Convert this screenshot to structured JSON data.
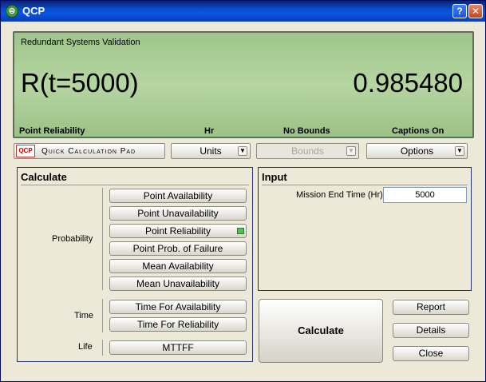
{
  "window": {
    "title": "QCP"
  },
  "display": {
    "title": "Redundant Systems Validation",
    "left_text": "R(t=5000)",
    "value": "0.985480",
    "captions": [
      "Point Reliability",
      "Hr",
      "No Bounds",
      "Captions On"
    ]
  },
  "toolbar": {
    "qcp_logo": "QCP",
    "qcp_label": "Quick Calculation Pad",
    "units": "Units",
    "bounds": "Bounds",
    "options": "Options"
  },
  "calculate": {
    "title": "Calculate",
    "probability_label": "Probability",
    "probability_buttons": [
      "Point Availability",
      "Point Unavailability",
      "Point Reliability",
      "Point Prob. of Failure",
      "Mean Availability",
      "Mean Unavailability"
    ],
    "selected": "Point Reliability",
    "time_label": "Time",
    "time_buttons": [
      "Time For Availability",
      "Time For Reliability"
    ],
    "life_label": "Life",
    "life_buttons": [
      "MTTFF"
    ]
  },
  "input": {
    "title": "Input",
    "mission_end_time_label": "Mission End Time (Hr)",
    "mission_end_time_value": "5000"
  },
  "actions": {
    "calculate": "Calculate",
    "report": "Report",
    "details": "Details",
    "close": "Close"
  },
  "colors": {
    "selected_indicator": "#4ec44e",
    "display_bg": "#b6d5a1"
  }
}
